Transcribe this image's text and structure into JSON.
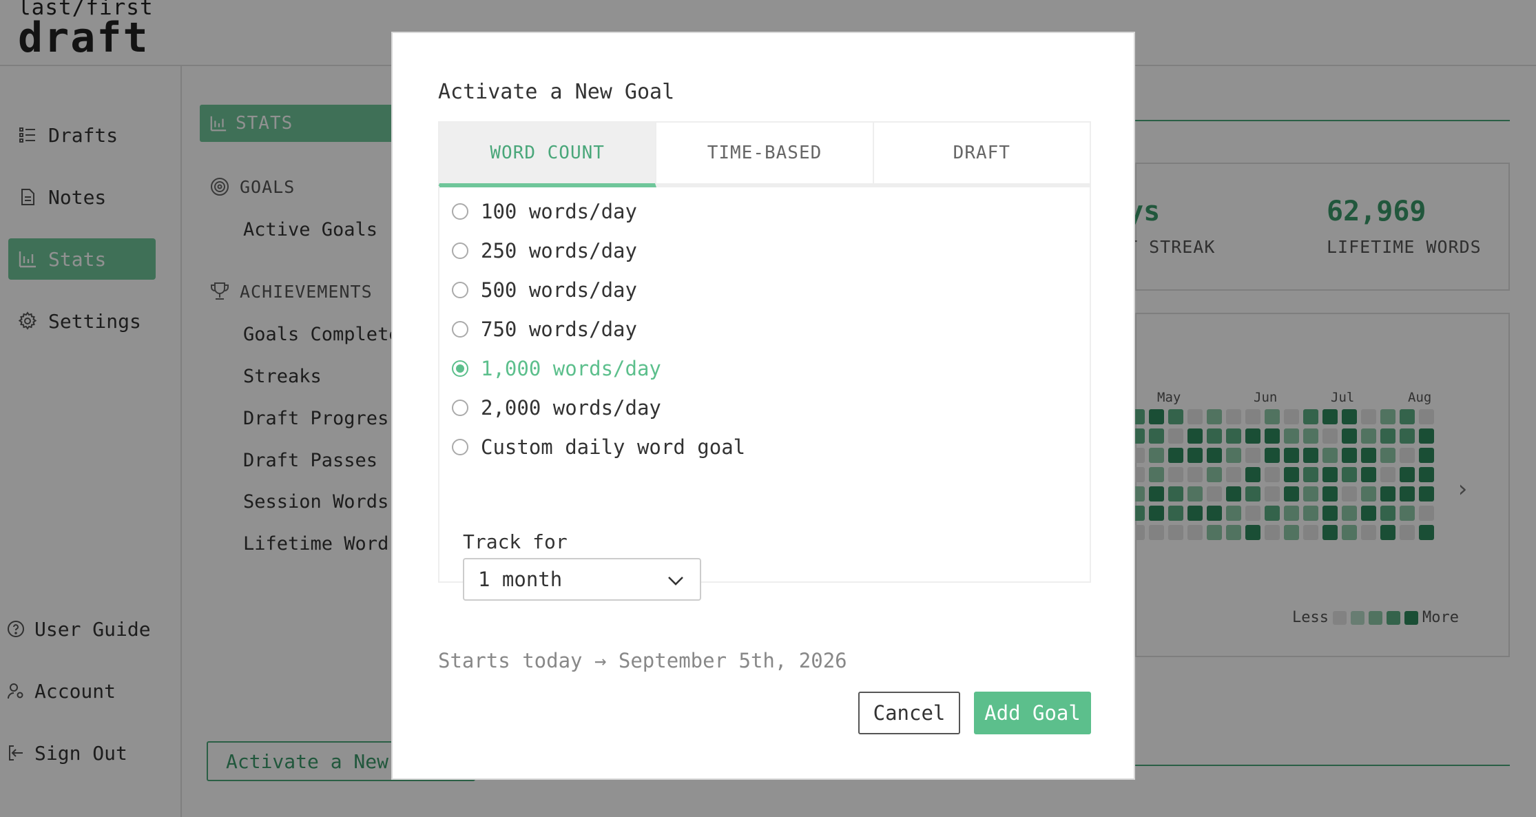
{
  "app": {
    "logo_top": "last/first",
    "logo_bottom": "draft"
  },
  "sidebar": {
    "items": [
      {
        "label": "Drafts",
        "icon": "list-icon"
      },
      {
        "label": "Notes",
        "icon": "document-icon"
      },
      {
        "label": "Stats",
        "icon": "bar-chart-icon",
        "active": true
      },
      {
        "label": "Settings",
        "icon": "gear-icon"
      }
    ],
    "bottom_items": [
      {
        "label": "User Guide",
        "icon": "help-circle-icon"
      },
      {
        "label": "Account",
        "icon": "user-settings-icon"
      },
      {
        "label": "Sign Out",
        "icon": "sign-out-icon"
      }
    ]
  },
  "subnav": {
    "stats_header": "STATS",
    "goals_header": "GOALS",
    "goals_links": [
      "Active Goals"
    ],
    "achievements_header": "ACHIEVEMENTS",
    "achievement_links": [
      "Goals Complete",
      "Streaks",
      "Draft Progres",
      "Draft Passes",
      "Session Words",
      "Lifetime Word"
    ],
    "activate_button": "Activate a New"
  },
  "main": {
    "streak_value": "ys",
    "streak_label": "T STREAK",
    "lifetime_words_value": "62,969",
    "lifetime_words_label": "LIFETIME WORDS",
    "heatmap_months": [
      "May",
      "Jun",
      "Jul",
      "Aug"
    ],
    "legend_less": "Less",
    "legend_more": "More"
  },
  "modal": {
    "title": "Activate a New Goal",
    "tabs": [
      {
        "label": "WORD COUNT",
        "active": true
      },
      {
        "label": "TIME-BASED",
        "active": false
      },
      {
        "label": "DRAFT",
        "active": false
      }
    ],
    "options": [
      {
        "label": "100 words/day",
        "selected": false
      },
      {
        "label": "250 words/day",
        "selected": false
      },
      {
        "label": "500 words/day",
        "selected": false
      },
      {
        "label": "750 words/day",
        "selected": false
      },
      {
        "label": "1,000 words/day",
        "selected": true
      },
      {
        "label": "2,000 words/day",
        "selected": false
      },
      {
        "label": "Custom daily word goal",
        "selected": false
      }
    ],
    "track_label": "Track for",
    "track_value": "1 month",
    "starts_text": "Starts today → September 5th, 2026",
    "cancel_label": "Cancel",
    "add_label": "Add Goal"
  },
  "colors": {
    "accent": "#5cbf8c",
    "accent_dark": "#3a9a6a",
    "overlay": "rgba(0,0,0,0.43)"
  }
}
